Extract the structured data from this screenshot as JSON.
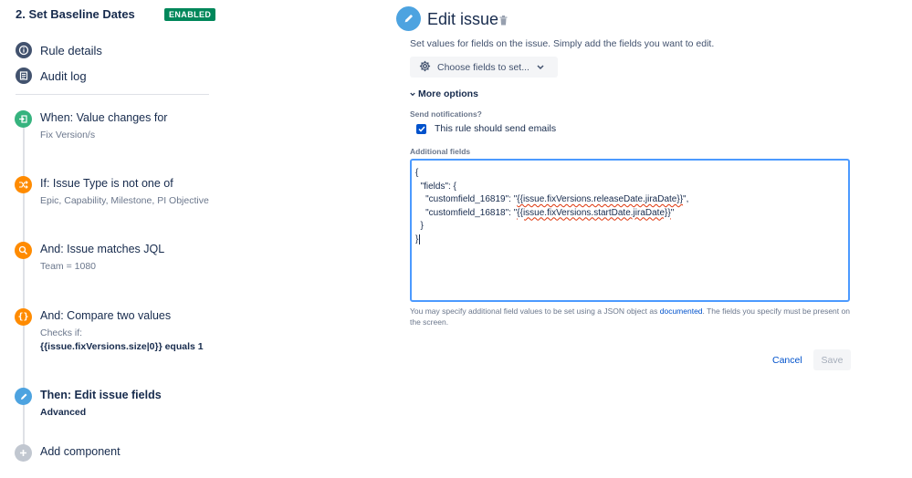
{
  "rule": {
    "title": "2. Set Baseline Dates",
    "status": "ENABLED"
  },
  "nav": [
    {
      "label": "Rule details",
      "icon": "info-icon"
    },
    {
      "label": "Audit log",
      "icon": "list-icon"
    }
  ],
  "steps": [
    {
      "title": "When: Value changes for",
      "subtitle": "Fix Version/s",
      "icon": "trigger-icon",
      "color": "#36b37e"
    },
    {
      "title": "If: Issue Type is not one of",
      "subtitle": "Epic, Capability, Milestone, PI Objective",
      "icon": "shuffle-icon",
      "color": "#ff8b00"
    },
    {
      "title": "And: Issue matches JQL",
      "subtitle": "Team = 1080",
      "icon": "search-icon",
      "color": "#ff8b00"
    },
    {
      "title": "And: Compare two values",
      "subtitle": "Checks if:",
      "subtitle2": "{{issue.fixVersions.size|0}} equals 1",
      "icon": "braces-icon",
      "color": "#ff8b00"
    },
    {
      "title": "Then: Edit issue fields",
      "subtitle": "Advanced",
      "icon": "pencil-icon",
      "color": "#4da3e0"
    },
    {
      "title": "Add component",
      "icon": "plus-icon",
      "color": "#c1c7d0"
    }
  ],
  "panel": {
    "title": "Edit issue",
    "description": "Set values for fields on the issue. Simply add the fields you want to edit.",
    "choose_fields": "Choose fields to set...",
    "more_options": "More options",
    "send_notifications_label": "Send notifications?",
    "send_notifications_text": "This rule should send emails",
    "send_notifications_checked": true,
    "additional_fields_label": "Additional fields",
    "json": {
      "l1": "{",
      "l2": "  \"fields\": {",
      "l3a": "    \"customfield_16819\": \"",
      "l3b": "{{issue.fixVersions.releaseDate.jiraDate}}",
      "l3c": "\",",
      "l4a": "    \"customfield_16818\": \"",
      "l4b": "{{issue.fixVersions.startDate.jiraDate}}",
      "l4c": "\"",
      "l5": "  }",
      "l6": "}"
    },
    "help_before": "You may specify additional field values to be set using a JSON object as ",
    "help_link": "documented",
    "help_after": ". The fields you specify must be present on the screen.",
    "cancel": "Cancel",
    "save": "Save"
  }
}
